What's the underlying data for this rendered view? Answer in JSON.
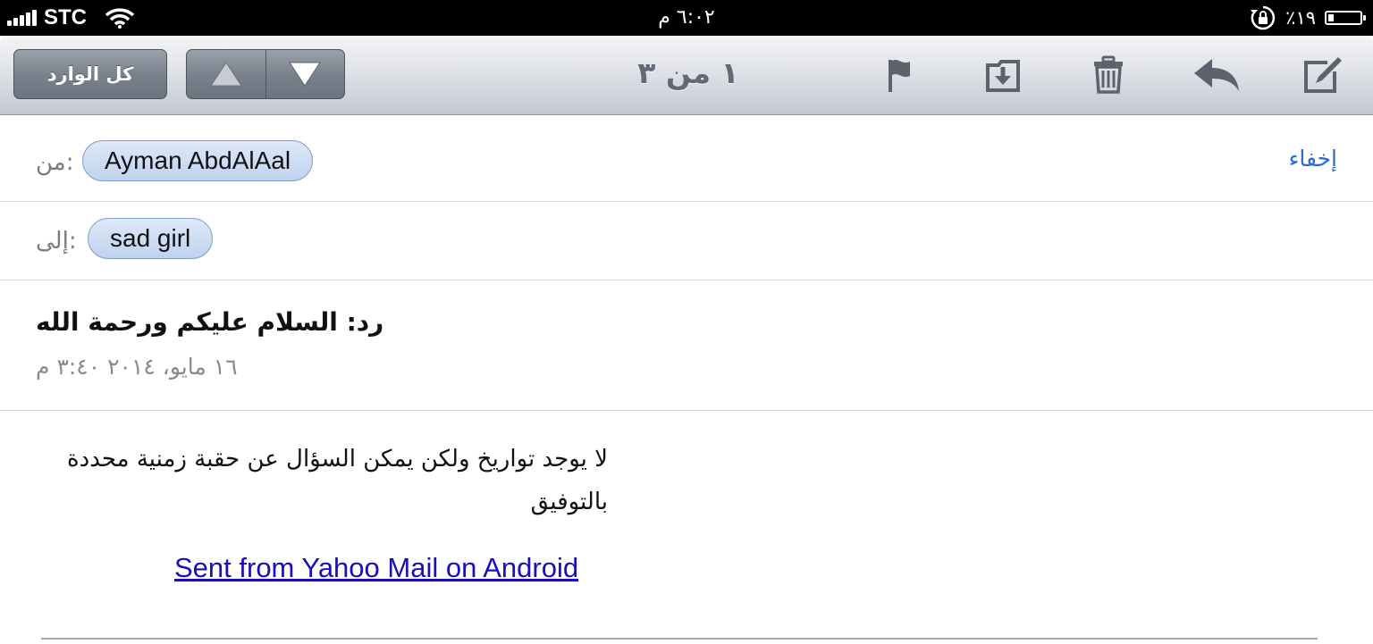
{
  "status_bar": {
    "carrier": "STC",
    "time": "٦:٠٢ م",
    "battery": "٪١٩",
    "battery_level": 0.19
  },
  "toolbar": {
    "inbox_label": "كل الوارد",
    "counter": "١ من ٣",
    "icons": [
      "arrow-up-icon",
      "arrow-down-icon",
      "flag-icon",
      "move-to-folder-icon",
      "trash-icon",
      "reply-icon",
      "compose-icon"
    ]
  },
  "header": {
    "from_label": "من:",
    "from_name": "Ayman AbdAlAal",
    "to_label": "إلى:",
    "to_name": "sad girl",
    "hide_label": "إخفاء"
  },
  "message": {
    "subject": "رد: السلام عليكم ورحمة الله",
    "date": "١٦ مايو، ٢٠١٤ ٣:٤٠ م",
    "body_line1": "لا يوجد تواريخ ولكن يمكن السؤال عن حقبة زمنية محددة",
    "body_line2": "بالتوفيق",
    "signature_link": "Sent from Yahoo Mail on Android"
  }
}
